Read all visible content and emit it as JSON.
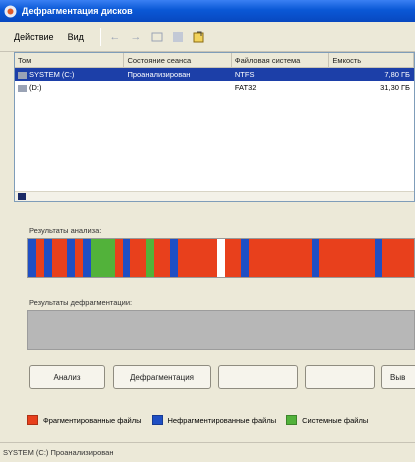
{
  "window": {
    "title": "Дефрагментация дисков"
  },
  "menu": [
    {
      "label": "Действие"
    },
    {
      "label": "Вид"
    }
  ],
  "toolbar": [
    {
      "icon": "back-arrow-icon"
    },
    {
      "icon": "forward-arrow-icon"
    },
    {
      "icon": "view-icon"
    },
    {
      "icon": "help-icon"
    },
    {
      "icon": "properties-icon"
    }
  ],
  "volumes": {
    "columns": [
      "Том",
      "Состояние сеанса",
      "Файловая система",
      "Емкость"
    ],
    "rows": [
      {
        "volume": "SYSTEM (C:)",
        "status": "Проанализирован",
        "fs": "NTFS",
        "capacity": "7,80 ГБ",
        "selected": true
      },
      {
        "volume": "(D:)",
        "status": "",
        "fs": "FAT32",
        "capacity": "31,30 ГБ",
        "selected": false
      }
    ]
  },
  "analysis": {
    "label": "Результаты анализа:"
  },
  "defrag": {
    "label": "Результаты дефрагментации:"
  },
  "buttons": {
    "analyze": "Анализ",
    "defragment": "Дефрагментация",
    "pause": "",
    "stop": "",
    "view_report": "Выв"
  },
  "legend": [
    {
      "label": "Фрагментированные файлы",
      "color": "#e8401c"
    },
    {
      "label": "Нефрагментированные файлы",
      "color": "#1f4fc4"
    },
    {
      "label": "Системные файлы",
      "color": "#52b23a"
    }
  ],
  "status": {
    "text": "SYSTEM (C:) Проанализирован"
  },
  "colors": {
    "fragmented": "#e8401c",
    "contiguous": "#1f4fc4",
    "system": "#52b23a",
    "free": "#ffffff"
  },
  "map_segments": [
    "contiguous",
    "fragmented",
    "contiguous",
    "fragmented",
    "fragmented",
    "contiguous",
    "fragmented",
    "contiguous",
    "system",
    "system",
    "system",
    "fragmented",
    "contiguous",
    "fragmented",
    "fragmented",
    "system",
    "fragmented",
    "fragmented",
    "contiguous",
    "fragmented",
    "fragmented",
    "fragmented",
    "fragmented",
    "fragmented",
    "free",
    "fragmented",
    "fragmented",
    "contiguous",
    "fragmented",
    "fragmented",
    "fragmented",
    "fragmented",
    "fragmented",
    "fragmented",
    "fragmented",
    "fragmented",
    "contiguous",
    "fragmented",
    "fragmented",
    "fragmented",
    "fragmented",
    "fragmented",
    "fragmented",
    "fragmented",
    "contiguous",
    "fragmented",
    "fragmented",
    "fragmented",
    "fragmented"
  ]
}
